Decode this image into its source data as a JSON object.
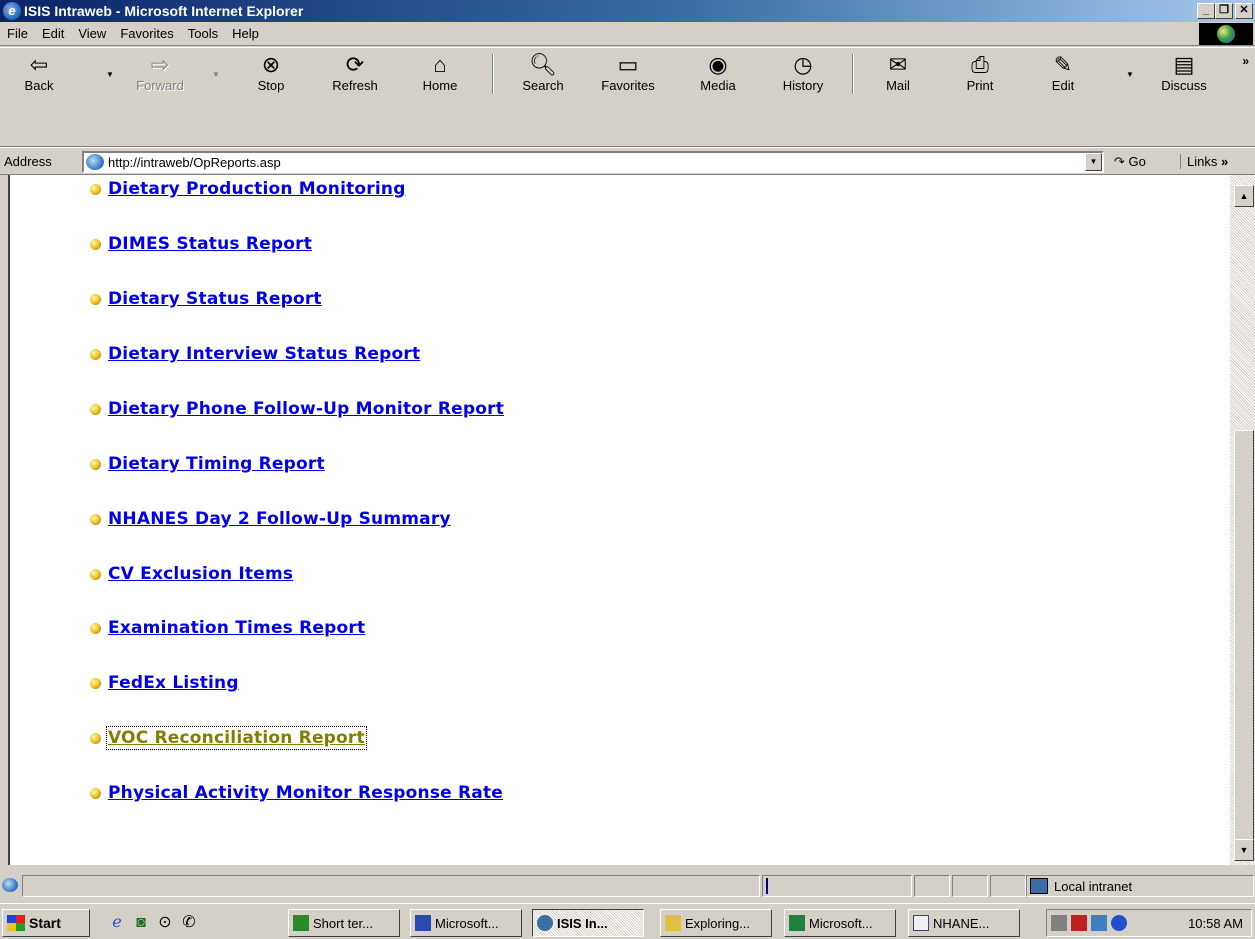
{
  "window": {
    "title": "ISIS Intraweb - Microsoft Internet Explorer"
  },
  "menu": [
    "File",
    "Edit",
    "View",
    "Favorites",
    "Tools",
    "Help"
  ],
  "toolbar": {
    "back": "Back",
    "forward": "Forward",
    "stop": "Stop",
    "refresh": "Refresh",
    "home": "Home",
    "search": "Search",
    "favorites": "Favorites",
    "media": "Media",
    "history": "History",
    "mail": "Mail",
    "print": "Print",
    "edit": "Edit",
    "discuss": "Discuss"
  },
  "address": {
    "label": "Address",
    "url": "http://intraweb/OpReports.asp",
    "go": "Go",
    "links": "Links"
  },
  "reports": [
    "Dietary Production Monitoring",
    "DIMES Status Report",
    "Dietary Status Report",
    "Dietary Interview Status Report",
    "Dietary Phone Follow-Up Monitor Report",
    "Dietary Timing Report",
    "NHANES Day 2 Follow-Up Summary",
    "CV Exclusion Items",
    "Examination Times Report",
    "FedEx Listing",
    "VOC Reconciliation Report",
    "Physical Activity Monitor Response Rate"
  ],
  "status": {
    "zone": "Local intranet"
  },
  "taskbar": {
    "start": "Start",
    "tasks": [
      "Short ter...",
      "Microsoft...",
      "ISIS In...",
      "Exploring...",
      "Microsoft...",
      "NHANE..."
    ],
    "clock": "10:58 AM"
  },
  "colors": {
    "link": "#0000ee",
    "visited": "#808000",
    "title_start": "#0a246a"
  }
}
